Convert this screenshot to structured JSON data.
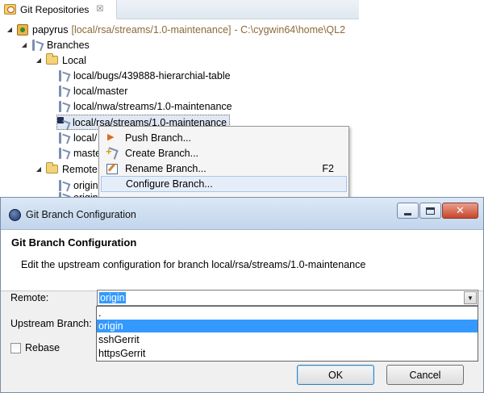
{
  "view": {
    "tab_label": "Git Repositories",
    "tab_close": "☒"
  },
  "tree": {
    "repo_name": "papyrus",
    "repo_branch": "[local/rsa/streams/1.0-maintenance]",
    "repo_path": "- C:\\cygwin64\\home\\QL2",
    "branches": "Branches",
    "local": "Local",
    "local_items": [
      "local/bugs/439888-hierarchial-table",
      "local/master",
      "local/nwa/streams/1.0-maintenance",
      "local/rsa/streams/1.0-maintenance",
      "local/",
      "maste"
    ],
    "remote": "Remote",
    "remote_items": [
      "origin",
      "origin"
    ]
  },
  "context_menu": {
    "items": [
      {
        "label": "Push Branch...",
        "shortcut": ""
      },
      {
        "label": "Create Branch...",
        "shortcut": ""
      },
      {
        "label": "Rename Branch...",
        "shortcut": "F2"
      },
      {
        "label": "Configure Branch...",
        "shortcut": ""
      }
    ],
    "hovered": "Configure Branch..."
  },
  "dialog": {
    "window_title": "Git Branch Configuration",
    "heading": "Git Branch Configuration",
    "description": "Edit the upstream configuration for branch local/rsa/streams/1.0-maintenance",
    "remote_label": "Remote:",
    "remote_value": "origin",
    "upstream_label": "Upstream Branch:",
    "rebase_label": "Rebase",
    "rebase_checked": false,
    "remote_options": [
      ".",
      "origin",
      "sshGerrit",
      "httpsGerrit"
    ],
    "selected_option": "origin",
    "ok_label": "OK",
    "cancel_label": "Cancel"
  },
  "colors": {
    "selection": "#3399ff",
    "repo_decoration": "#8c6a3a"
  }
}
